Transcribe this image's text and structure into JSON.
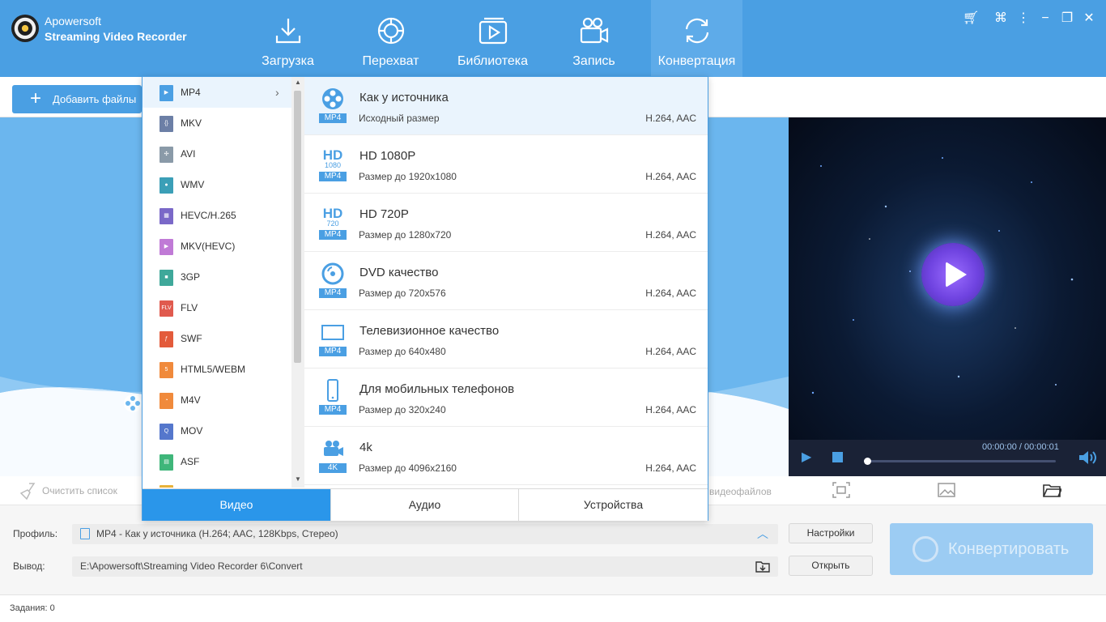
{
  "app": {
    "brand": "Apowersoft",
    "name": "Streaming Video Recorder"
  },
  "nav": [
    {
      "label": "Загрузка",
      "icon": "download-icon"
    },
    {
      "label": "Перехват",
      "icon": "capture-icon"
    },
    {
      "label": "Библиотека",
      "icon": "library-icon"
    },
    {
      "label": "Запись",
      "icon": "record-icon"
    },
    {
      "label": "Конвертация",
      "icon": "convert-icon",
      "active": true
    }
  ],
  "window_controls": [
    "cart-icon",
    "settings-icon",
    "more-icon",
    "minimize-icon",
    "restore-icon",
    "close-icon"
  ],
  "toolbar": {
    "add_files": "Добавить файлы"
  },
  "formats": {
    "items": [
      "MP4",
      "MKV",
      "AVI",
      "WMV",
      "HEVC/H.265",
      "MKV(HEVC)",
      "3GP",
      "FLV",
      "SWF",
      "HTML5/WEBM",
      "M4V",
      "MOV",
      "ASF"
    ],
    "selected": "MP4",
    "colors": [
      "#4a9fe3",
      "#6c7fa6",
      "#8a9aa8",
      "#3b9fb7",
      "#7a68c8",
      "#c07ad6",
      "#3fa89a",
      "#e05a4e",
      "#e35b3b",
      "#f08a3c",
      "#f08a3c",
      "#5577cc",
      "#3fb67a"
    ],
    "glyphs": [
      "▶",
      "{}",
      "✣",
      "●",
      "▦",
      "▶",
      "■",
      "FLV",
      "ƒ",
      "5",
      "◔",
      "Q",
      "▤"
    ]
  },
  "presets": [
    {
      "title": "Как у источника",
      "desc": "Исходный размер",
      "codec": "H.264, AAC",
      "badge": "MP4",
      "icon": "film-reel-icon"
    },
    {
      "title": "HD 1080P",
      "desc": "Размер до 1920x1080",
      "codec": "H.264, AAC",
      "badge": "MP4",
      "icon": "hd-1080-icon",
      "sub": "1080"
    },
    {
      "title": "HD 720P",
      "desc": "Размер до 1280x720",
      "codec": "H.264, AAC",
      "badge": "MP4",
      "icon": "hd-720-icon",
      "sub": "720"
    },
    {
      "title": "DVD качество",
      "desc": "Размер до 720x576",
      "codec": "H.264, AAC",
      "badge": "MP4",
      "icon": "dvd-icon"
    },
    {
      "title": "Телевизионное качество",
      "desc": "Размер до 640x480",
      "codec": "H.264, AAC",
      "badge": "MP4",
      "icon": "tv-icon"
    },
    {
      "title": "Для мобильных телефонов",
      "desc": "Размер до 320x240",
      "codec": "H.264, AAC",
      "badge": "MP4",
      "icon": "mobile-icon"
    },
    {
      "title": "4k",
      "desc": "Размер до 4096x2160",
      "codec": "H.264, AAC",
      "badge": "4K",
      "icon": "camera-icon"
    }
  ],
  "tabs": {
    "video": "Видео",
    "audio": "Аудио",
    "devices": "Устройства"
  },
  "player": {
    "time": "00:00:00 / 00:00:01"
  },
  "bottom": {
    "clear_list": "Очистить список",
    "videofiles": "видеофайлов"
  },
  "settings": {
    "profile_label": "Профиль:",
    "profile_value": "MP4 - Как у источника (H.264; AAC, 128Kbps, Стерео)",
    "output_label": "Вывод:",
    "output_value": "E:\\Apowersoft\\Streaming Video Recorder 6\\Convert",
    "settings_btn": "Настройки",
    "open_btn": "Открыть",
    "convert_btn": "Конвертировать"
  },
  "status": "Задания: 0"
}
